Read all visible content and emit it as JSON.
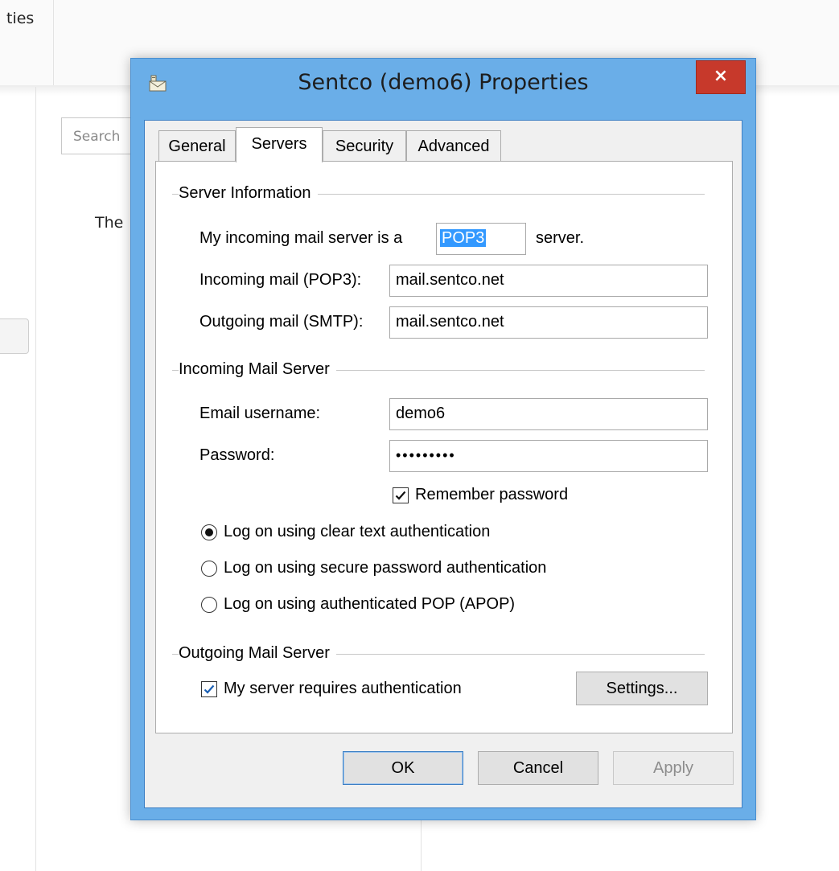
{
  "background": {
    "header_text": "ties",
    "search_placeholder": "Search",
    "body_text": "The"
  },
  "dialog": {
    "title": "Sentco (demo6) Properties",
    "close_label": "×",
    "tabs": [
      "General",
      "Servers",
      "Security",
      "Advanced"
    ],
    "active_tab": "Servers",
    "server_info": {
      "group_title": "Server Information",
      "incoming_type_prefix": "My incoming mail server is a",
      "incoming_type_value": "POP3",
      "incoming_type_suffix": "server.",
      "incoming_label": "Incoming mail (POP3):",
      "incoming_value": "mail.sentco.net",
      "outgoing_label": "Outgoing mail (SMTP):",
      "outgoing_value": "mail.sentco.net"
    },
    "incoming_server": {
      "group_title": "Incoming Mail Server",
      "username_label": "Email username:",
      "username_value": "demo6",
      "password_label": "Password:",
      "password_value": "•••••••••",
      "remember_label": "Remember password",
      "remember_checked": true,
      "auth_options": [
        {
          "label": "Log on using clear text authentication",
          "selected": true
        },
        {
          "label": "Log on using secure password authentication",
          "selected": false
        },
        {
          "label": "Log on using authenticated POP (APOP)",
          "selected": false
        }
      ]
    },
    "outgoing_server": {
      "group_title": "Outgoing Mail Server",
      "requires_auth_label": "My server requires authentication",
      "requires_auth_checked": true,
      "settings_label": "Settings..."
    },
    "buttons": {
      "ok": "OK",
      "cancel": "Cancel",
      "apply": "Apply"
    }
  },
  "colors": {
    "titlebar": "#6aaee8",
    "close_button": "#c7392b",
    "selection": "#3399ff"
  }
}
